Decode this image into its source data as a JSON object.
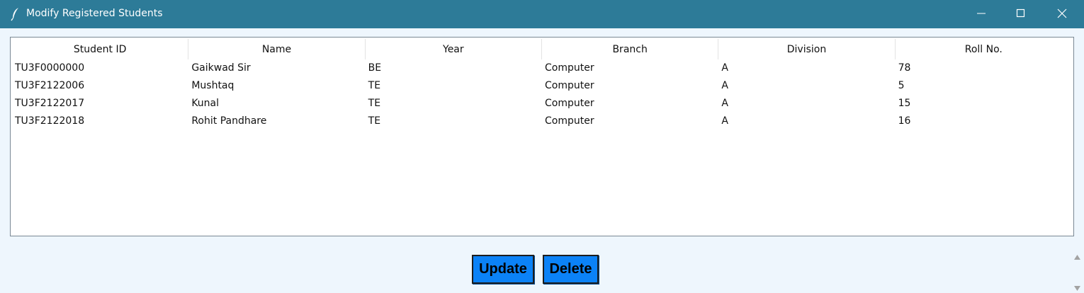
{
  "window": {
    "title": "Modify Registered Students",
    "app_icon": "feather-icon",
    "controls": [
      "minimize-icon",
      "maximize-icon",
      "close-icon"
    ]
  },
  "table": {
    "columns": [
      "Student ID",
      "Name",
      "Year",
      "Branch",
      "Division",
      "Roll No."
    ],
    "rows": [
      [
        "TU3F0000000",
        "Gaikwad Sir",
        "BE",
        "Computer",
        "A",
        "78"
      ],
      [
        "TU3F2122006",
        "Mushtaq",
        "TE",
        "Computer",
        "A",
        "5"
      ],
      [
        "TU3F2122017",
        "Kunal",
        "TE",
        "Computer",
        "A",
        "15"
      ],
      [
        "TU3F2122018",
        "Rohit Pandhare",
        "TE",
        "Computer",
        "A",
        "16"
      ]
    ]
  },
  "actions": {
    "update_label": "Update",
    "delete_label": "Delete"
  },
  "colors": {
    "titlebar": "#2d7b98",
    "window_bg": "#eef6fd",
    "button": "#0b82f7"
  }
}
